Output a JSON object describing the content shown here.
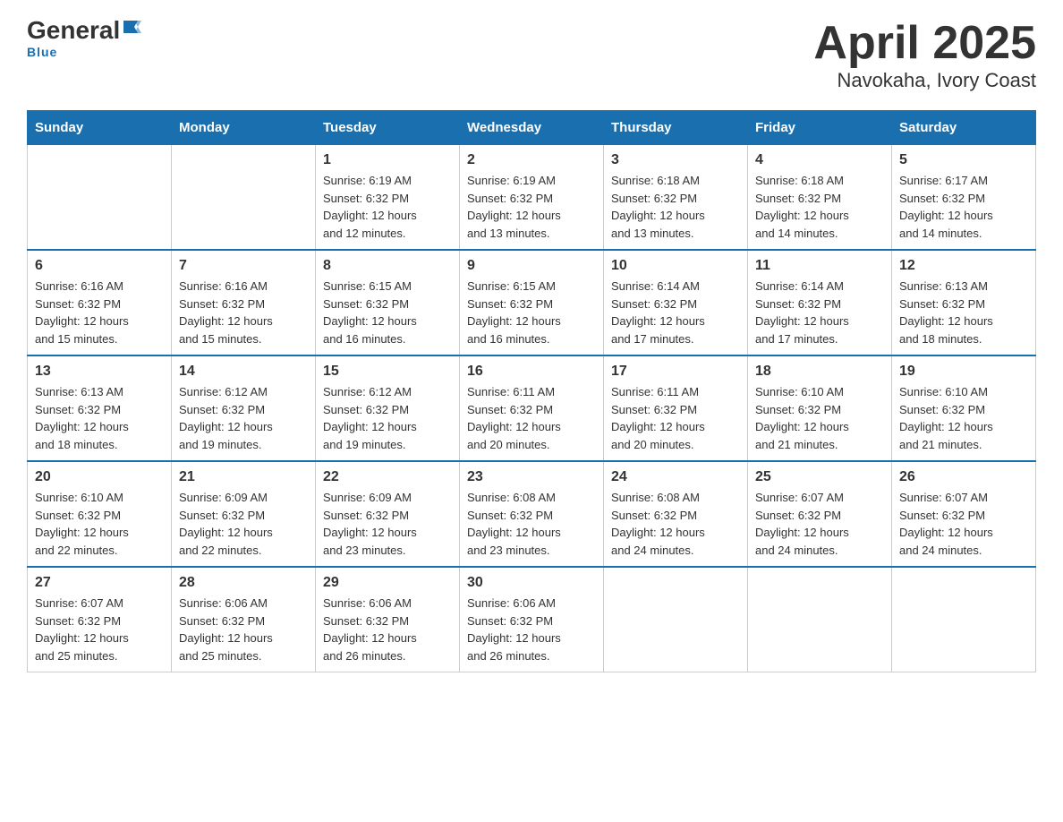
{
  "logo": {
    "text_general": "General",
    "text_blue": "Blue",
    "arrow": "▶"
  },
  "title": "April 2025",
  "subtitle": "Navokaha, Ivory Coast",
  "days_header": [
    "Sunday",
    "Monday",
    "Tuesday",
    "Wednesday",
    "Thursday",
    "Friday",
    "Saturday"
  ],
  "weeks": [
    [
      {
        "day": "",
        "info": ""
      },
      {
        "day": "",
        "info": ""
      },
      {
        "day": "1",
        "info": "Sunrise: 6:19 AM\nSunset: 6:32 PM\nDaylight: 12 hours\nand 12 minutes."
      },
      {
        "day": "2",
        "info": "Sunrise: 6:19 AM\nSunset: 6:32 PM\nDaylight: 12 hours\nand 13 minutes."
      },
      {
        "day": "3",
        "info": "Sunrise: 6:18 AM\nSunset: 6:32 PM\nDaylight: 12 hours\nand 13 minutes."
      },
      {
        "day": "4",
        "info": "Sunrise: 6:18 AM\nSunset: 6:32 PM\nDaylight: 12 hours\nand 14 minutes."
      },
      {
        "day": "5",
        "info": "Sunrise: 6:17 AM\nSunset: 6:32 PM\nDaylight: 12 hours\nand 14 minutes."
      }
    ],
    [
      {
        "day": "6",
        "info": "Sunrise: 6:16 AM\nSunset: 6:32 PM\nDaylight: 12 hours\nand 15 minutes."
      },
      {
        "day": "7",
        "info": "Sunrise: 6:16 AM\nSunset: 6:32 PM\nDaylight: 12 hours\nand 15 minutes."
      },
      {
        "day": "8",
        "info": "Sunrise: 6:15 AM\nSunset: 6:32 PM\nDaylight: 12 hours\nand 16 minutes."
      },
      {
        "day": "9",
        "info": "Sunrise: 6:15 AM\nSunset: 6:32 PM\nDaylight: 12 hours\nand 16 minutes."
      },
      {
        "day": "10",
        "info": "Sunrise: 6:14 AM\nSunset: 6:32 PM\nDaylight: 12 hours\nand 17 minutes."
      },
      {
        "day": "11",
        "info": "Sunrise: 6:14 AM\nSunset: 6:32 PM\nDaylight: 12 hours\nand 17 minutes."
      },
      {
        "day": "12",
        "info": "Sunrise: 6:13 AM\nSunset: 6:32 PM\nDaylight: 12 hours\nand 18 minutes."
      }
    ],
    [
      {
        "day": "13",
        "info": "Sunrise: 6:13 AM\nSunset: 6:32 PM\nDaylight: 12 hours\nand 18 minutes."
      },
      {
        "day": "14",
        "info": "Sunrise: 6:12 AM\nSunset: 6:32 PM\nDaylight: 12 hours\nand 19 minutes."
      },
      {
        "day": "15",
        "info": "Sunrise: 6:12 AM\nSunset: 6:32 PM\nDaylight: 12 hours\nand 19 minutes."
      },
      {
        "day": "16",
        "info": "Sunrise: 6:11 AM\nSunset: 6:32 PM\nDaylight: 12 hours\nand 20 minutes."
      },
      {
        "day": "17",
        "info": "Sunrise: 6:11 AM\nSunset: 6:32 PM\nDaylight: 12 hours\nand 20 minutes."
      },
      {
        "day": "18",
        "info": "Sunrise: 6:10 AM\nSunset: 6:32 PM\nDaylight: 12 hours\nand 21 minutes."
      },
      {
        "day": "19",
        "info": "Sunrise: 6:10 AM\nSunset: 6:32 PM\nDaylight: 12 hours\nand 21 minutes."
      }
    ],
    [
      {
        "day": "20",
        "info": "Sunrise: 6:10 AM\nSunset: 6:32 PM\nDaylight: 12 hours\nand 22 minutes."
      },
      {
        "day": "21",
        "info": "Sunrise: 6:09 AM\nSunset: 6:32 PM\nDaylight: 12 hours\nand 22 minutes."
      },
      {
        "day": "22",
        "info": "Sunrise: 6:09 AM\nSunset: 6:32 PM\nDaylight: 12 hours\nand 23 minutes."
      },
      {
        "day": "23",
        "info": "Sunrise: 6:08 AM\nSunset: 6:32 PM\nDaylight: 12 hours\nand 23 minutes."
      },
      {
        "day": "24",
        "info": "Sunrise: 6:08 AM\nSunset: 6:32 PM\nDaylight: 12 hours\nand 24 minutes."
      },
      {
        "day": "25",
        "info": "Sunrise: 6:07 AM\nSunset: 6:32 PM\nDaylight: 12 hours\nand 24 minutes."
      },
      {
        "day": "26",
        "info": "Sunrise: 6:07 AM\nSunset: 6:32 PM\nDaylight: 12 hours\nand 24 minutes."
      }
    ],
    [
      {
        "day": "27",
        "info": "Sunrise: 6:07 AM\nSunset: 6:32 PM\nDaylight: 12 hours\nand 25 minutes."
      },
      {
        "day": "28",
        "info": "Sunrise: 6:06 AM\nSunset: 6:32 PM\nDaylight: 12 hours\nand 25 minutes."
      },
      {
        "day": "29",
        "info": "Sunrise: 6:06 AM\nSunset: 6:32 PM\nDaylight: 12 hours\nand 26 minutes."
      },
      {
        "day": "30",
        "info": "Sunrise: 6:06 AM\nSunset: 6:32 PM\nDaylight: 12 hours\nand 26 minutes."
      },
      {
        "day": "",
        "info": ""
      },
      {
        "day": "",
        "info": ""
      },
      {
        "day": "",
        "info": ""
      }
    ]
  ]
}
